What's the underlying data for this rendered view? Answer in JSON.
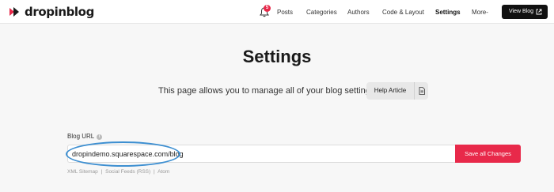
{
  "brand": {
    "name": "dropinblog",
    "accent": "#e8294a"
  },
  "nav": {
    "notification_count": "5",
    "items": [
      {
        "label": "Posts"
      },
      {
        "label": "Categories"
      },
      {
        "label": "Authors"
      },
      {
        "label": "Code & Layout"
      },
      {
        "label": "Settings",
        "active": true
      },
      {
        "label": "More-"
      }
    ],
    "view_blog": "View Blog"
  },
  "page": {
    "title": "Settings",
    "description": "This page allows you to manage all of your blog settings.",
    "help_article": "Help Article"
  },
  "blog_url": {
    "label": "Blog URL",
    "info_icon": "i",
    "value": "dropindemo.squarespace.com/blog",
    "save_label": "Save all Changes",
    "links": {
      "xml_sitemap": "XML Sitemap",
      "separator": "|",
      "social_feeds": "Social Feeds (RSS)",
      "atom": "Atom"
    }
  },
  "annotation": {
    "color": "#3d8fd1"
  }
}
